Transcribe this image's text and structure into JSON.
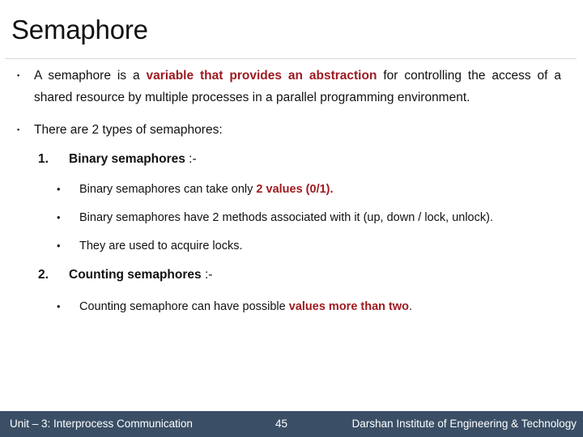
{
  "slide": {
    "title": "Semaphore",
    "accent_red": "#9e1b20",
    "footer_bg": "#3a4f66",
    "rule_color": "#d8d8d8"
  },
  "bullets": {
    "marker_square": "▪",
    "marker_dot": "•"
  },
  "body": {
    "p1": {
      "text_a": "A semaphore is a ",
      "text_b": "variable that provides an abstraction",
      "text_c": " for controlling the access of a shared resource by multiple processes in a parallel programming environment."
    },
    "p2": {
      "text": "There are 2 types of semaphores:"
    },
    "item1": {
      "number": "1.",
      "heading": "Binary semaphores",
      "suffix": " :-"
    },
    "item1_sub1": {
      "text_a": "Binary semaphores can take only ",
      "text_b": "2 values (0/1)."
    },
    "item1_sub2": {
      "text": "Binary semaphores have 2 methods associated with it (up, down / lock, unlock)."
    },
    "item1_sub3": {
      "text": "They are used to acquire locks."
    },
    "item2": {
      "number": "2.",
      "heading": "Counting semaphores",
      "suffix": " :-"
    },
    "item2_sub1": {
      "text_a": "Counting semaphore can have possible ",
      "text_b": "values more than two",
      "text_c": "."
    }
  },
  "footer": {
    "left": "Unit – 3: Interprocess Communication",
    "page": "45",
    "right": "Darshan Institute of Engineering & Technology"
  }
}
